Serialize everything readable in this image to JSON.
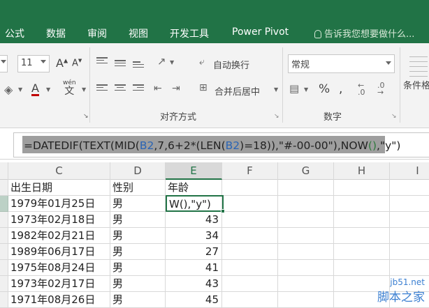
{
  "ribbon_tabs": [
    "公式",
    "数据",
    "审阅",
    "视图",
    "开发工具",
    "Power Pivot"
  ],
  "tell_me": "告诉我您想要做什么...",
  "font_size": "11",
  "font_grow": "A",
  "font_shrink": "A",
  "wen_label": "wén",
  "wen_char": "文",
  "wrap_text": "自动换行",
  "merge_center": "合并后居中",
  "number_format": "常规",
  "conditional_format": "条件格",
  "group_alignment": "对齐方式",
  "group_number": "数字",
  "formula_text": [
    {
      "t": "=DATEDIF(TEXT(MID(",
      "c": "plain"
    },
    {
      "t": "B2",
      "c": "ref"
    },
    {
      "t": ",7,6+2*(LEN(",
      "c": "plain"
    },
    {
      "t": "B2",
      "c": "ref"
    },
    {
      "t": ")=18)),\"#-00-00\"),NOW",
      "c": "plain"
    },
    {
      "t": "()",
      "c": "par"
    },
    {
      "t": ",\"y\")",
      "c": "plain"
    }
  ],
  "columns": [
    "C",
    "D",
    "E",
    "F",
    "G",
    "H",
    "I"
  ],
  "headers": {
    "c": "出生日期",
    "d": "性别",
    "e": "年龄"
  },
  "editing_text": "W(),\"y\")",
  "rows": [
    {
      "c": "1979年01月25日",
      "d": "男",
      "e": ""
    },
    {
      "c": "1973年02月18日",
      "d": "男",
      "e": "43"
    },
    {
      "c": "1982年02月21日",
      "d": "男",
      "e": "34"
    },
    {
      "c": "1989年06月17日",
      "d": "男",
      "e": "27"
    },
    {
      "c": "1975年08月24日",
      "d": "男",
      "e": "41"
    },
    {
      "c": "1973年02月17日",
      "d": "男",
      "e": "43"
    },
    {
      "c": "1971年08月26日",
      "d": "男",
      "e": "45"
    }
  ],
  "watermark": {
    "line1": "jb51.net",
    "line2": "脚本之家"
  },
  "colors": {
    "ribbon_green": "#217346",
    "ref_blue": "#2a64b4"
  }
}
